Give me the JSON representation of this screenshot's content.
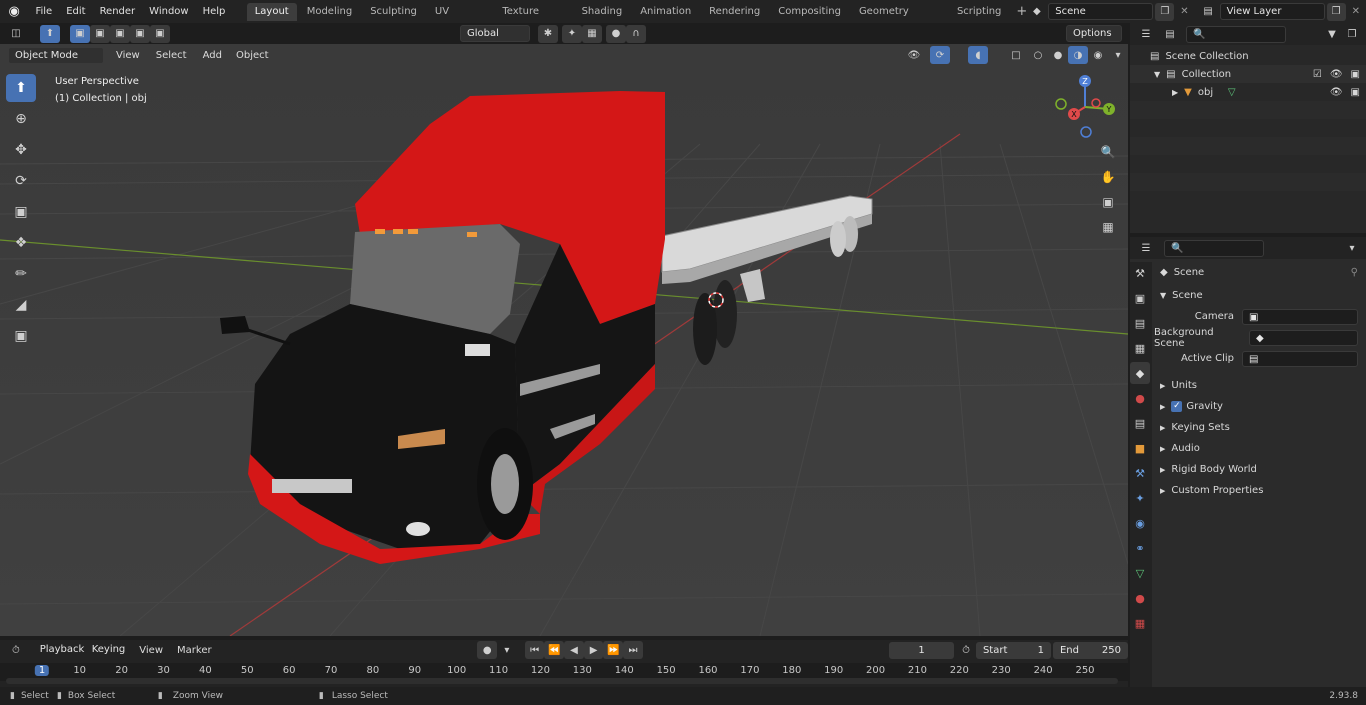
{
  "app": {
    "logo": "blender-icon",
    "version": "2.93.8"
  },
  "menu": [
    "File",
    "Edit",
    "Render",
    "Window",
    "Help"
  ],
  "workspaces": [
    "Layout",
    "Modeling",
    "Sculpting",
    "UV Editing",
    "Texture Paint",
    "Shading",
    "Animation",
    "Rendering",
    "Compositing",
    "Geometry Nodes",
    "Scripting"
  ],
  "active_workspace": "Layout",
  "scene_field": "Scene",
  "view_layer_field": "View Layer",
  "viewport_header": {
    "transform_orientation": "Global",
    "options": "Options"
  },
  "viewport_menu": {
    "mode": "Object Mode",
    "items": [
      "View",
      "Select",
      "Add",
      "Object"
    ]
  },
  "viewport_overlay": {
    "perspective": "User Perspective",
    "collection": "(1) Collection | obj"
  },
  "gizmo": {
    "z": "Z",
    "y": "Y",
    "x": "X"
  },
  "outliner": {
    "root": "Scene Collection",
    "collection": "Collection",
    "object": "obj"
  },
  "properties": {
    "context": "Scene",
    "panel_title": "Scene",
    "camera_label": "Camera",
    "background_label": "Background Scene",
    "clip_label": "Active Clip",
    "subpanels": [
      "Units",
      "Gravity",
      "Keying Sets",
      "Audio",
      "Rigid Body World",
      "Custom Properties"
    ]
  },
  "timeline": {
    "menus": [
      "Playback",
      "Keying",
      "View",
      "Marker"
    ],
    "current_frame": "1",
    "start_label": "Start",
    "start": "1",
    "end_label": "End",
    "end": "250",
    "ruler": [
      "1",
      "10",
      "20",
      "30",
      "40",
      "50",
      "60",
      "70",
      "80",
      "90",
      "100",
      "110",
      "120",
      "130",
      "140",
      "150",
      "160",
      "170",
      "180",
      "190",
      "200",
      "210",
      "220",
      "230",
      "240",
      "250"
    ]
  },
  "statusbar": {
    "select": "Select",
    "box_select": "Box Select",
    "zoom": "Zoom View",
    "lasso": "Lasso Select"
  },
  "colors": {
    "accent": "#4772b3",
    "truck_red": "#d41717",
    "truck_black": "#151515"
  }
}
